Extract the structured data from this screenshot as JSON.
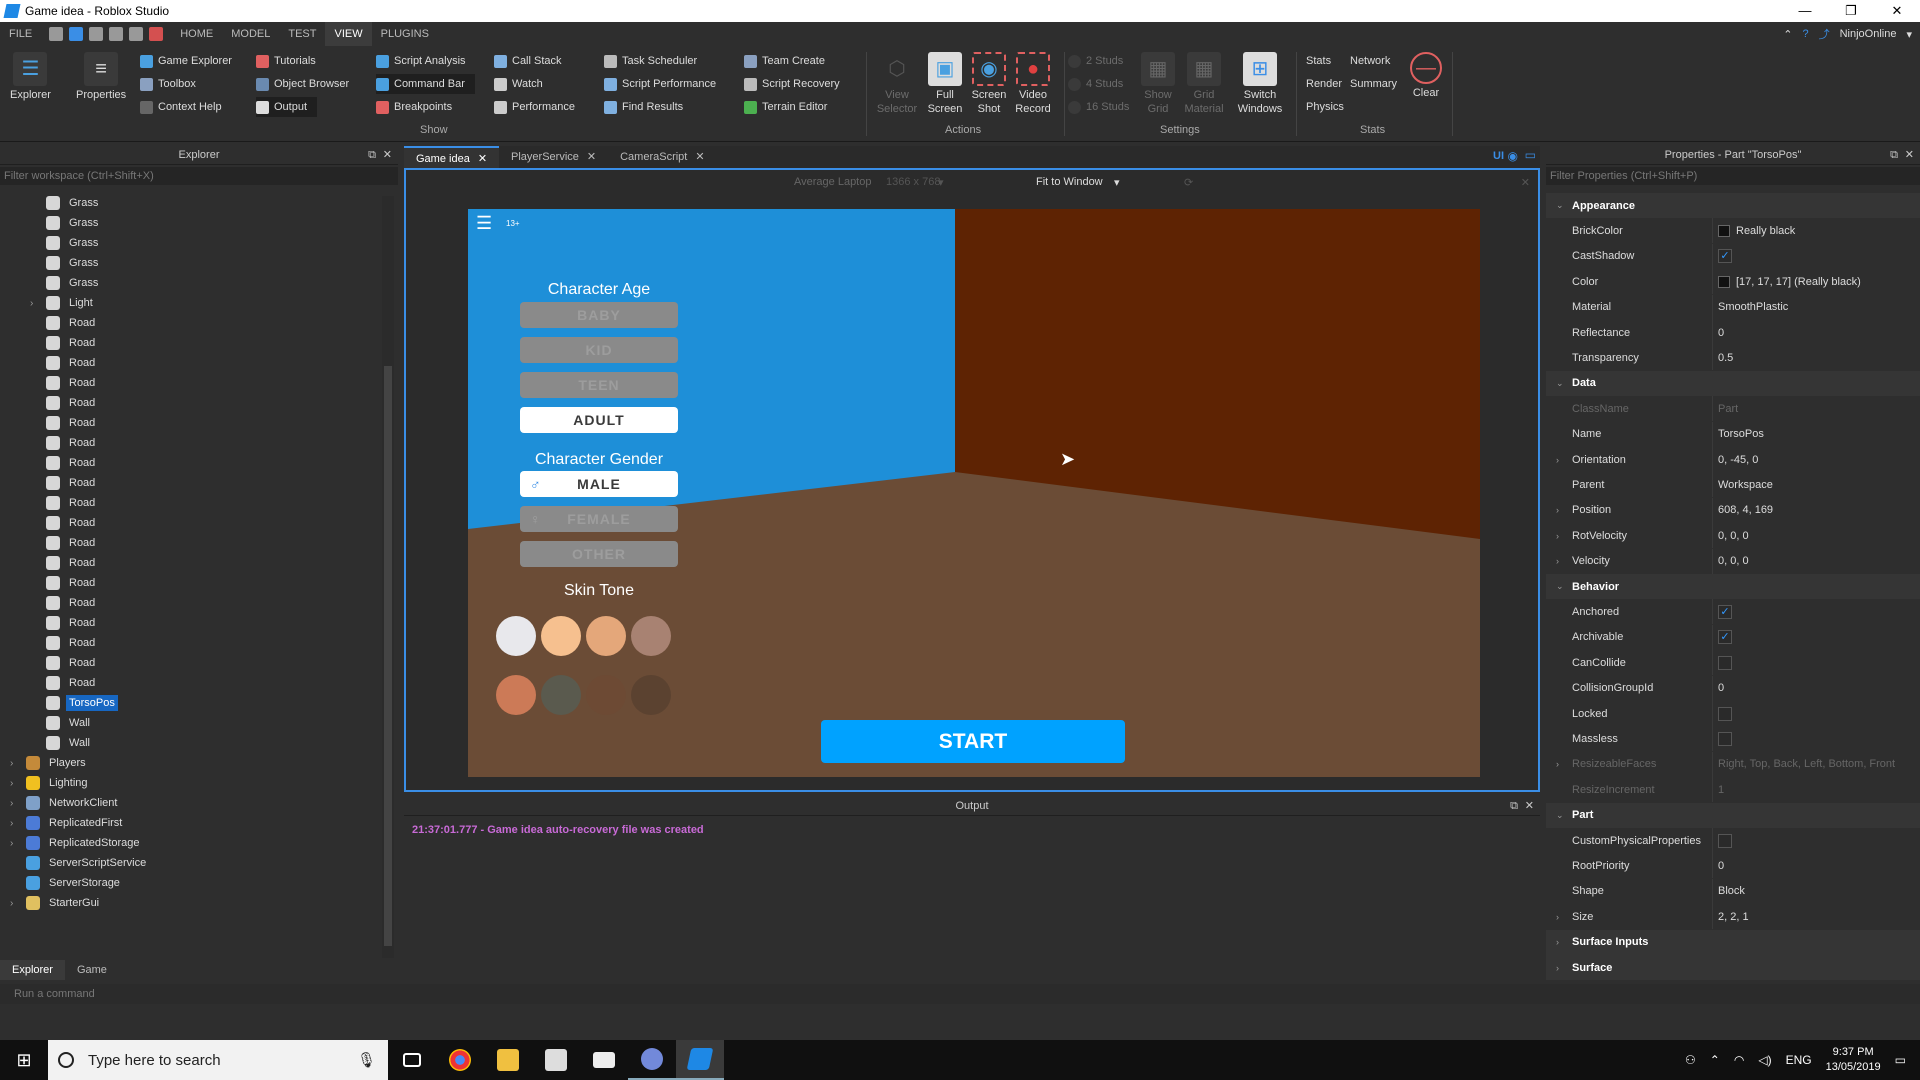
{
  "window": {
    "title": "Game idea - Roblox Studio",
    "min": "—",
    "max": "❐",
    "close": "✕"
  },
  "menu": {
    "tabs": [
      "FILE",
      "HOME",
      "MODEL",
      "TEST",
      "VIEW",
      "PLUGINS"
    ],
    "active": "VIEW",
    "user": "NinjoOnline"
  },
  "ribbon": {
    "explorer": "Explorer",
    "properties": "Properties",
    "col1": [
      "Game Explorer",
      "Toolbox",
      "Context Help"
    ],
    "col2": [
      "Tutorials",
      "Object Browser",
      "Output"
    ],
    "col3": [
      "Script Analysis",
      "Command Bar",
      "Breakpoints"
    ],
    "col4": [
      "Call Stack",
      "Watch",
      "Performance"
    ],
    "col5": [
      "Task Scheduler",
      "Script Performance",
      "Find Results"
    ],
    "col6": [
      "Team Create",
      "Script Recovery",
      "Terrain Editor"
    ],
    "show_label": "Show",
    "actions": {
      "view_selector": "View Selector",
      "full_screen": "Full Screen",
      "screen_shot": "Screen Shot",
      "video_record": "Video Record",
      "label": "Actions"
    },
    "settings": {
      "studs": [
        "2 Studs",
        "4 Studs",
        "16 Studs"
      ],
      "show_grid": "Show Grid",
      "grid_material": "Grid Material",
      "switch_windows": "Switch Windows",
      "label": "Settings"
    },
    "stats": {
      "items": [
        "Stats",
        "Network",
        "Render",
        "Summary",
        "Physics"
      ],
      "clear": "Clear",
      "label": "Stats"
    }
  },
  "explorer": {
    "title": "Explorer",
    "filter_placeholder": "Filter workspace (Ctrl+Shift+X)",
    "tree": [
      {
        "label": "Grass",
        "depth": 2
      },
      {
        "label": "Grass",
        "depth": 2
      },
      {
        "label": "Grass",
        "depth": 2
      },
      {
        "label": "Grass",
        "depth": 2
      },
      {
        "label": "Grass",
        "depth": 2
      },
      {
        "label": "Light",
        "depth": 2,
        "expand": true
      },
      {
        "label": "Road",
        "depth": 2
      },
      {
        "label": "Road",
        "depth": 2
      },
      {
        "label": "Road",
        "depth": 2
      },
      {
        "label": "Road",
        "depth": 2
      },
      {
        "label": "Road",
        "depth": 2
      },
      {
        "label": "Road",
        "depth": 2
      },
      {
        "label": "Road",
        "depth": 2
      },
      {
        "label": "Road",
        "depth": 2
      },
      {
        "label": "Road",
        "depth": 2
      },
      {
        "label": "Road",
        "depth": 2
      },
      {
        "label": "Road",
        "depth": 2
      },
      {
        "label": "Road",
        "depth": 2
      },
      {
        "label": "Road",
        "depth": 2
      },
      {
        "label": "Road",
        "depth": 2
      },
      {
        "label": "Road",
        "depth": 2
      },
      {
        "label": "Road",
        "depth": 2
      },
      {
        "label": "Road",
        "depth": 2
      },
      {
        "label": "Road",
        "depth": 2
      },
      {
        "label": "Road",
        "depth": 2
      },
      {
        "label": "TorsoPos",
        "depth": 2,
        "selected": true
      },
      {
        "label": "Wall",
        "depth": 2
      },
      {
        "label": "Wall",
        "depth": 2
      },
      {
        "label": "Players",
        "depth": 1,
        "expand": true,
        "icon": "#c48a3a"
      },
      {
        "label": "Lighting",
        "depth": 1,
        "expand": true,
        "icon": "#f0c020"
      },
      {
        "label": "NetworkClient",
        "depth": 1,
        "expand": true,
        "icon": "#7fa0c8"
      },
      {
        "label": "ReplicatedFirst",
        "depth": 1,
        "expand": true,
        "icon": "#4c7bd6"
      },
      {
        "label": "ReplicatedStorage",
        "depth": 1,
        "expand": true,
        "icon": "#4c7bd6"
      },
      {
        "label": "ServerScriptService",
        "depth": 1,
        "icon": "#4aa0e0"
      },
      {
        "label": "ServerStorage",
        "depth": 1,
        "icon": "#4aa0e0"
      },
      {
        "label": "StarterGui",
        "depth": 1,
        "expand": true,
        "icon": "#e0c060"
      }
    ],
    "bottom_tabs": [
      "Explorer",
      "Game"
    ]
  },
  "doc_tabs": [
    "Game idea",
    "PlayerService",
    "CameraScript"
  ],
  "viewport": {
    "device": "Average Laptop",
    "resolution": "1366 x 768",
    "fit": "Fit to Window",
    "ui_toggle": "UI",
    "age_rating": "13+",
    "age_title": "Character Age",
    "ages": [
      "BABY",
      "KID",
      "TEEN",
      "ADULT"
    ],
    "age_selected": 3,
    "gender_title": "Character Gender",
    "genders": [
      "MALE",
      "FEMALE",
      "OTHER"
    ],
    "gender_selected": 0,
    "skin_title": "Skin Tone",
    "skin_tones": [
      "#e8e8ec",
      "#f6c08f",
      "#e4a77a",
      "#a88272",
      "#cc7a57",
      "#5a5a4e",
      "#6d4a34",
      "#4e3a2c"
    ],
    "start": "START"
  },
  "output": {
    "title": "Output",
    "log": "21:37:01.777 - Game idea auto-recovery file was created"
  },
  "properties": {
    "title": "Properties - Part \"TorsoPos\"",
    "filter_placeholder": "Filter Properties (Ctrl+Shift+P)",
    "rows": [
      {
        "cat": "Appearance"
      },
      {
        "name": "BrickColor",
        "value": "Really black",
        "swatch": "#111111"
      },
      {
        "name": "CastShadow",
        "check": true
      },
      {
        "name": "Color",
        "value": "[17, 17, 17] (Really black)",
        "swatch": "#111111"
      },
      {
        "name": "Material",
        "value": "SmoothPlastic"
      },
      {
        "name": "Reflectance",
        "value": "0"
      },
      {
        "name": "Transparency",
        "value": "0.5"
      },
      {
        "cat": "Data"
      },
      {
        "name": "ClassName",
        "value": "Part",
        "dim": true
      },
      {
        "name": "Name",
        "value": "TorsoPos"
      },
      {
        "name": "Orientation",
        "value": "0, -45, 0",
        "expand": true
      },
      {
        "name": "Parent",
        "value": "Workspace"
      },
      {
        "name": "Position",
        "value": "608, 4, 169",
        "expand": true
      },
      {
        "name": "RotVelocity",
        "value": "0, 0, 0",
        "expand": true
      },
      {
        "name": "Velocity",
        "value": "0, 0, 0",
        "expand": true
      },
      {
        "cat": "Behavior"
      },
      {
        "name": "Anchored",
        "check": true
      },
      {
        "name": "Archivable",
        "check": true
      },
      {
        "name": "CanCollide",
        "check": false
      },
      {
        "name": "CollisionGroupId",
        "value": "0"
      },
      {
        "name": "Locked",
        "check": false
      },
      {
        "name": "Massless",
        "check": false
      },
      {
        "name": "ResizeableFaces",
        "value": "Right, Top, Back, Left, Bottom, Front",
        "dim": true,
        "expand": true
      },
      {
        "name": "ResizeIncrement",
        "value": "1",
        "dim": true
      },
      {
        "cat": "Part"
      },
      {
        "name": "CustomPhysicalProperties",
        "check": false
      },
      {
        "name": "RootPriority",
        "value": "0"
      },
      {
        "name": "Shape",
        "value": "Block"
      },
      {
        "name": "Size",
        "value": "2, 2, 1",
        "expand": true
      },
      {
        "cat": "Surface Inputs",
        "collapsed": true
      },
      {
        "cat": "Surface",
        "collapsed": true
      }
    ]
  },
  "command_bar": {
    "placeholder": "Run a command"
  },
  "taskbar": {
    "search": "Type here to search",
    "lang": "ENG",
    "time": "9:37 PM",
    "date": "13/05/2019"
  }
}
